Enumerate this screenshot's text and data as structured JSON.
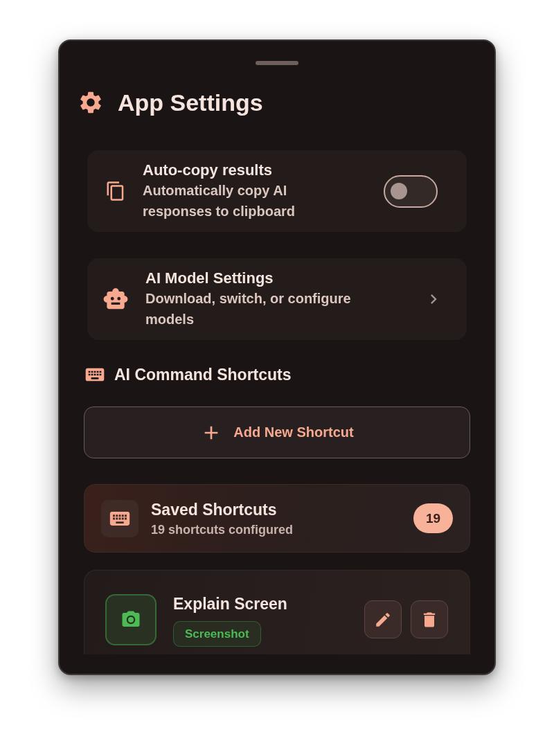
{
  "window": {
    "title": "App Settings"
  },
  "settings": [
    {
      "kind": "toggle",
      "title": "Auto-copy results",
      "description": "Automatically copy AI responses to clipboard",
      "on": false
    },
    {
      "kind": "link",
      "title": "AI Model Settings",
      "description": "Download, switch, or configure models"
    }
  ],
  "shortcuts_section": {
    "title": "AI Command Shortcuts",
    "add_button": "Add New Shortcut",
    "saved": {
      "title": "Saved Shortcuts",
      "subtitle": "19 shortcuts configured",
      "count": "19"
    },
    "items": [
      {
        "name": "Explain Screen",
        "tag": "Screenshot",
        "color": "#4cbb55"
      }
    ]
  }
}
